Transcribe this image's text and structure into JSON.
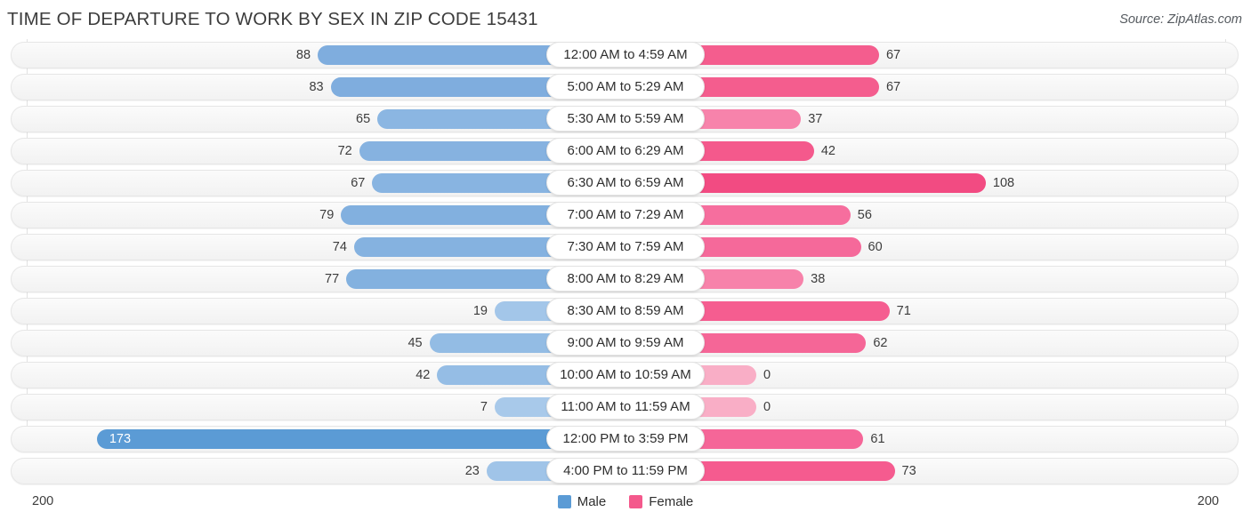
{
  "header": {
    "title": "TIME OF DEPARTURE TO WORK BY SEX IN ZIP CODE 15431",
    "source": "Source: ZipAtlas.com"
  },
  "axis": {
    "left_label": "200",
    "right_label": "200"
  },
  "legend": {
    "items": [
      {
        "label": "Male",
        "color": "#5b9bd5"
      },
      {
        "label": "Female",
        "color": "#f4598c"
      }
    ]
  },
  "chart_data": {
    "type": "bar",
    "orientation": "horizontal-diverging",
    "title": "TIME OF DEPARTURE TO WORK BY SEX IN ZIP CODE 15431",
    "subtitle": "",
    "xlabel": "",
    "ylabel": "",
    "xlim": [
      200,
      200
    ],
    "axis_max": 200,
    "grid": true,
    "legend_position": "bottom-center",
    "categories": [
      "12:00 AM to 4:59 AM",
      "5:00 AM to 5:29 AM",
      "5:30 AM to 5:59 AM",
      "6:00 AM to 6:29 AM",
      "6:30 AM to 6:59 AM",
      "7:00 AM to 7:29 AM",
      "7:30 AM to 7:59 AM",
      "8:00 AM to 8:29 AM",
      "8:30 AM to 8:59 AM",
      "9:00 AM to 9:59 AM",
      "10:00 AM to 10:59 AM",
      "11:00 AM to 11:59 AM",
      "12:00 PM to 3:59 PM",
      "4:00 PM to 11:59 PM"
    ],
    "series": [
      {
        "name": "Male",
        "color": "#5b9bd5",
        "values": [
          88,
          83,
          65,
          72,
          67,
          79,
          74,
          77,
          19,
          45,
          42,
          7,
          173,
          23
        ]
      },
      {
        "name": "Female",
        "color": "#f4598c",
        "values": [
          67,
          67,
          37,
          42,
          108,
          56,
          60,
          38,
          71,
          62,
          0,
          0,
          61,
          73
        ]
      }
    ],
    "rows": [
      {
        "category": "12:00 AM to 4:59 AM",
        "male": 88,
        "female": 67,
        "male_color": "#7fadde",
        "female_color": "#f45d8e",
        "male_label_inside": false
      },
      {
        "category": "5:00 AM to 5:29 AM",
        "male": 83,
        "female": 67,
        "male_color": "#7fadde",
        "female_color": "#f45d8e",
        "male_label_inside": false
      },
      {
        "category": "5:30 AM to 5:59 AM",
        "male": 65,
        "female": 37,
        "male_color": "#8bb6e2",
        "female_color": "#f783ab",
        "male_label_inside": false
      },
      {
        "category": "6:00 AM to 6:29 AM",
        "male": 72,
        "female": 42,
        "male_color": "#86b2e0",
        "female_color": "#f77cа6",
        "male_label_inside": false
      },
      {
        "category": "6:30 AM to 6:59 AM",
        "male": 67,
        "female": 108,
        "male_color": "#88b4e1",
        "female_color": "#f24b82",
        "male_label_inside": false
      },
      {
        "category": "7:00 AM to 7:29 AM",
        "male": 79,
        "female": 56,
        "male_color": "#82b0df",
        "female_color": "#f66e9e",
        "male_label_inside": false
      },
      {
        "category": "7:30 AM to 7:59 AM",
        "male": 74,
        "female": 60,
        "male_color": "#85b2e0",
        "female_color": "#f5699a",
        "male_label_inside": false
      },
      {
        "category": "8:00 AM to 8:29 AM",
        "male": 77,
        "female": 38,
        "male_color": "#83b1df",
        "female_color": "#f782aa",
        "male_label_inside": false
      },
      {
        "category": "8:30 AM to 8:59 AM",
        "male": 19,
        "female": 71,
        "male_color": "#a3c6e9",
        "female_color": "#f55d90",
        "male_label_inside": false
      },
      {
        "category": "9:00 AM to 9:59 AM",
        "male": 45,
        "female": 62,
        "male_color": "#93bce4",
        "female_color": "#f56697",
        "male_label_inside": false
      },
      {
        "category": "10:00 AM to 10:59 AM",
        "male": 42,
        "female": 0,
        "male_color": "#95bde5",
        "female_color": "#f9aec6",
        "male_label_inside": false
      },
      {
        "category": "11:00 AM to 11:59 AM",
        "male": 7,
        "female": 0,
        "male_color": "#a8c9ea",
        "female_color": "#f9aec6",
        "male_label_inside": false
      },
      {
        "category": "12:00 PM to 3:59 PM",
        "male": 173,
        "female": 61,
        "male_color": "#5b9bd5",
        "female_color": "#f56698",
        "male_label_inside": true
      },
      {
        "category": "4:00 PM to 11:59 PM",
        "male": 23,
        "female": 73,
        "male_color": "#a0c4e8",
        "female_color": "#f55b8f",
        "male_label_inside": false
      }
    ]
  }
}
